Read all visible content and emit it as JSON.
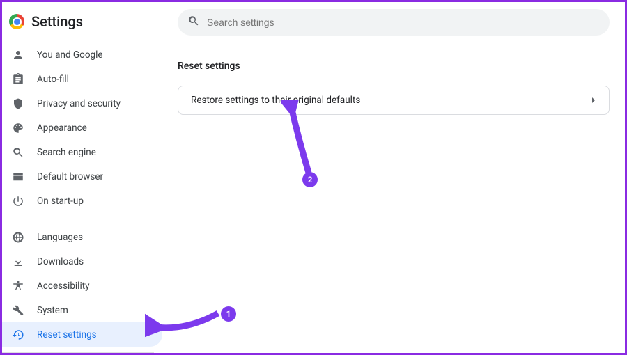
{
  "header": {
    "title": "Settings"
  },
  "search": {
    "placeholder": "Search settings"
  },
  "sidebar": {
    "groups": [
      {
        "items": [
          {
            "label": "You and Google"
          },
          {
            "label": "Auto-fill"
          },
          {
            "label": "Privacy and security"
          },
          {
            "label": "Appearance"
          },
          {
            "label": "Search engine"
          },
          {
            "label": "Default browser"
          },
          {
            "label": "On start-up"
          }
        ]
      },
      {
        "items": [
          {
            "label": "Languages"
          },
          {
            "label": "Downloads"
          },
          {
            "label": "Accessibility"
          },
          {
            "label": "System"
          },
          {
            "label": "Reset settings",
            "active": true
          }
        ]
      }
    ]
  },
  "main": {
    "section_title": "Reset settings",
    "rows": [
      {
        "label": "Restore settings to their original defaults"
      }
    ]
  },
  "annotations": {
    "callouts": [
      "1",
      "2"
    ]
  }
}
